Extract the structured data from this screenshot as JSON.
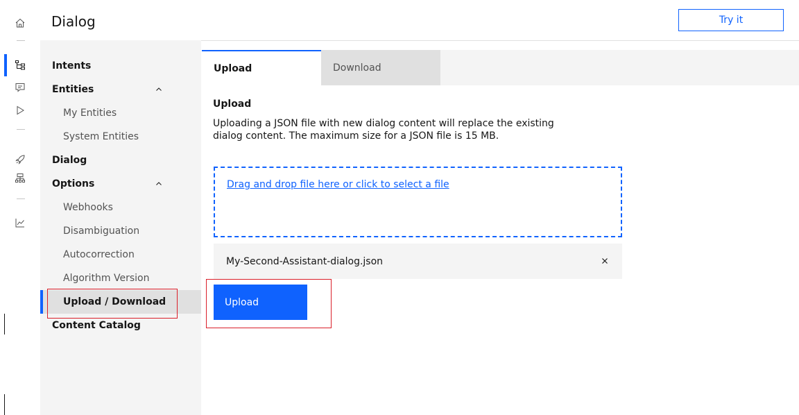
{
  "header": {
    "title": "Dialog",
    "try_label": "Try it"
  },
  "rail": {
    "items": [
      "home-icon",
      "dialog-tree-icon",
      "chat-icon",
      "play-icon",
      "rocket-icon",
      "integrations-icon",
      "analytics-icon"
    ],
    "active": "dialog-tree-icon"
  },
  "sidebar": {
    "items": [
      {
        "label": "Intents"
      },
      {
        "label": "Entities"
      },
      {
        "label": "My Entities"
      },
      {
        "label": "System Entities"
      },
      {
        "label": "Dialog"
      },
      {
        "label": "Options"
      },
      {
        "label": "Webhooks"
      },
      {
        "label": "Disambiguation"
      },
      {
        "label": "Autocorrection"
      },
      {
        "label": "Algorithm Version"
      },
      {
        "label": "Upload / Download"
      },
      {
        "label": "Content Catalog"
      }
    ],
    "selected": "Upload / Download"
  },
  "tabs": [
    {
      "label": "Upload"
    },
    {
      "label": "Download"
    }
  ],
  "upload": {
    "title": "Upload",
    "description": "Uploading a JSON file with new dialog content will replace the existing dialog content. The maximum size for a JSON file is 15 MB.",
    "dropzone_text": "Drag and drop file here or click to select a file",
    "file_name": "My-Second-Assistant-dialog.json",
    "button_label": "Upload"
  },
  "colors": {
    "accent": "#0f62fe",
    "highlight": "#da1e28",
    "nav_bg": "#f4f4f4"
  }
}
